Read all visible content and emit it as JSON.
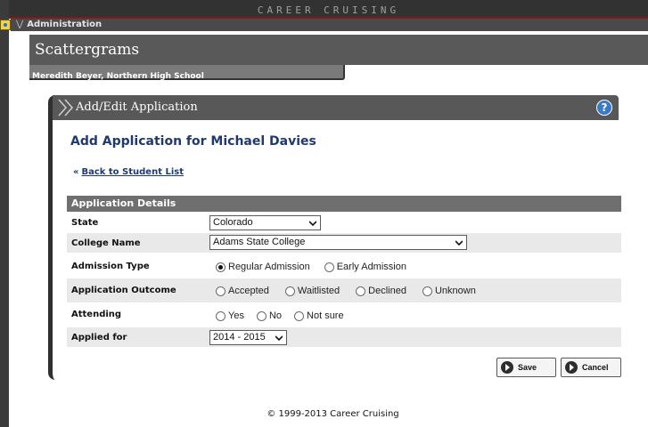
{
  "brand": "CAREER CRUISING",
  "admin_bar": {
    "label": "Administration"
  },
  "page_title": "Scattergrams",
  "user_info": "Meredith Beyer, Northern High School",
  "panel": {
    "title": "Add/Edit Application",
    "help": "?"
  },
  "heading": "Add Application for Michael Davies",
  "back_link": {
    "arrow": "«",
    "label": "Back to Student List"
  },
  "details": {
    "header": "Application Details",
    "state": {
      "label": "State",
      "value": "Colorado"
    },
    "college": {
      "label": "College Name",
      "value": "Adams State College"
    },
    "admission_type": {
      "label": "Admission Type",
      "options": [
        "Regular Admission",
        "Early Admission"
      ],
      "selected": "Regular Admission"
    },
    "outcome": {
      "label": "Application Outcome",
      "options": [
        "Accepted",
        "Waitlisted",
        "Declined",
        "Unknown"
      ],
      "selected": null
    },
    "attending": {
      "label": "Attending",
      "options": [
        "Yes",
        "No",
        "Not sure"
      ],
      "selected": null
    },
    "applied_for": {
      "label": "Applied for",
      "value": "2014 - 2015"
    }
  },
  "buttons": {
    "save": "Save",
    "cancel": "Cancel"
  },
  "footer": "© 1999-2013 Career Cruising",
  "colors": {
    "heading": "#1f3a6f",
    "dark_bar": "#323232",
    "header_gray": "#585858",
    "help_blue": "#3a79c7"
  }
}
